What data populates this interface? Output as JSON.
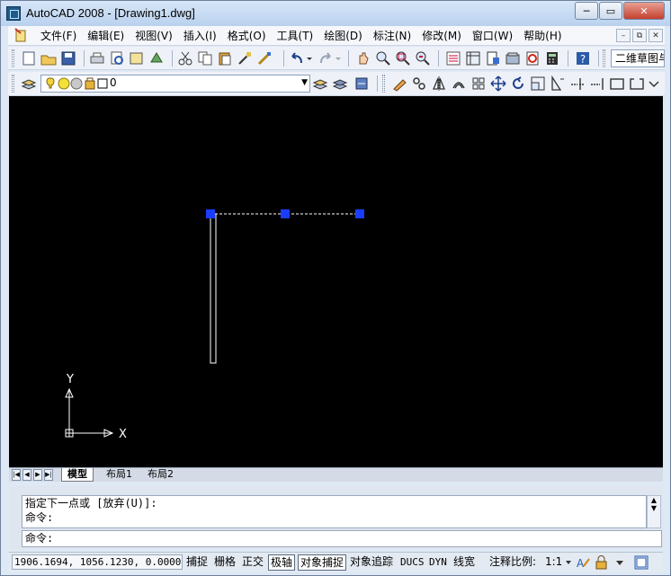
{
  "window": {
    "title": "AutoCAD 2008 - [Drawing1.dwg]",
    "buttons": {
      "minimize": "─",
      "maximize": "▭",
      "close": "✕"
    }
  },
  "menubar": {
    "items": [
      "文件(F)",
      "编辑(E)",
      "视图(V)",
      "插入(I)",
      "格式(O)",
      "工具(T)",
      "绘图(D)",
      "标注(N)",
      "修改(M)",
      "窗口(W)",
      "帮助(H)"
    ],
    "doc_buttons": [
      "–",
      "⧉",
      "✕"
    ]
  },
  "toolbar_standard": {
    "workspace_value": "二维草图与注释"
  },
  "toolbar_layers": {
    "layer_value": "0"
  },
  "layout_tabs": {
    "tabs": [
      "模型",
      "布局1",
      "布局2"
    ],
    "active": "模型"
  },
  "ucs": {
    "x_label": "X",
    "y_label": "Y"
  },
  "command": {
    "history_lines": [
      "指定下一点或 [放弃(U)]:",
      "命令:"
    ],
    "prompt": "命令:"
  },
  "statusbar": {
    "coordinates": "1906.1694, 1056.1230, 0.0000",
    "toggles": [
      {
        "label": "捕捉",
        "on": false
      },
      {
        "label": "栅格",
        "on": false
      },
      {
        "label": "正交",
        "on": false
      },
      {
        "label": "极轴",
        "on": true
      },
      {
        "label": "对象捕捉",
        "on": true
      },
      {
        "label": "对象追踪",
        "on": false
      },
      {
        "label": "DUCS",
        "on": false
      },
      {
        "label": "DYN",
        "on": false
      },
      {
        "label": "线宽",
        "on": false
      }
    ],
    "annotation_scale_label": "注释比例:",
    "annotation_scale_value": "1:1"
  },
  "colors": {
    "canvas": "#000000",
    "grip": "#1a3cff",
    "geometry": "#ffffff"
  }
}
